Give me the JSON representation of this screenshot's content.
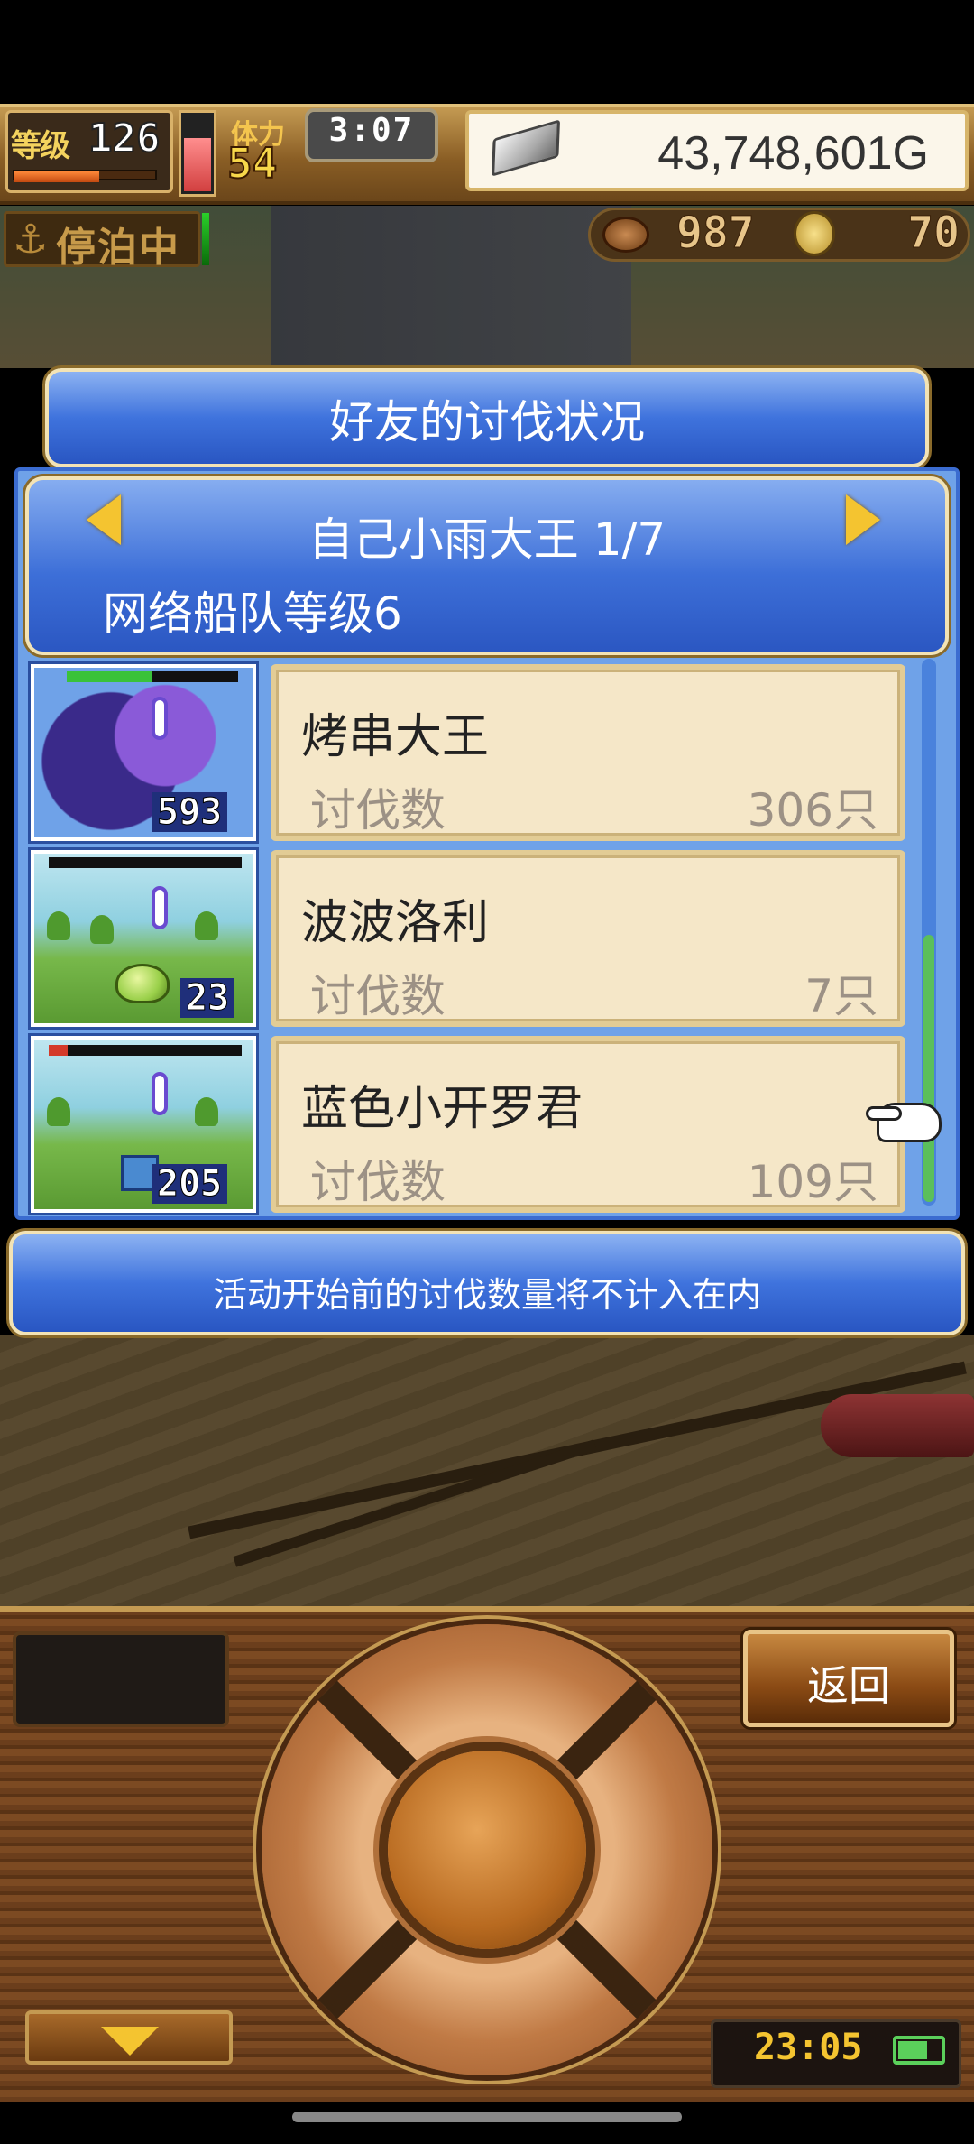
{
  "hud": {
    "level_label": "等级",
    "level_value": "126",
    "exp_fraction": 0.6,
    "stamina_label": "体力",
    "stamina_value": "54",
    "stamina_fraction": 0.7,
    "timer": "3:07",
    "gold": "43,748,601G",
    "status": "停泊中",
    "resource_1": "987",
    "resource_2": "70"
  },
  "dialog": {
    "title": "好友的讨伐状况",
    "fleet_name": "自己小雨大王 1/7",
    "fleet_level": "网络船队等级6",
    "rows": [
      {
        "name": "烤串大王",
        "label": "讨伐数",
        "count": "306只",
        "monster_level": "593",
        "hp_fraction": 0.5
      },
      {
        "name": "波波洛利",
        "label": "讨伐数",
        "count": "7只",
        "monster_level": "23",
        "hp_fraction": 0.0
      },
      {
        "name": "蓝色小开罗君",
        "label": "讨伐数",
        "count": "109只",
        "monster_level": "205",
        "hp_fraction": 0.1
      }
    ],
    "footer": "活动开始前的讨伐数量将不计入在内"
  },
  "controls": {
    "back_label": "返回",
    "clock": "23:05"
  },
  "colors": {
    "panel_blue": "#3f73dd",
    "card_bg": "#f5e7c8",
    "gold_accent": "#f4c430"
  }
}
